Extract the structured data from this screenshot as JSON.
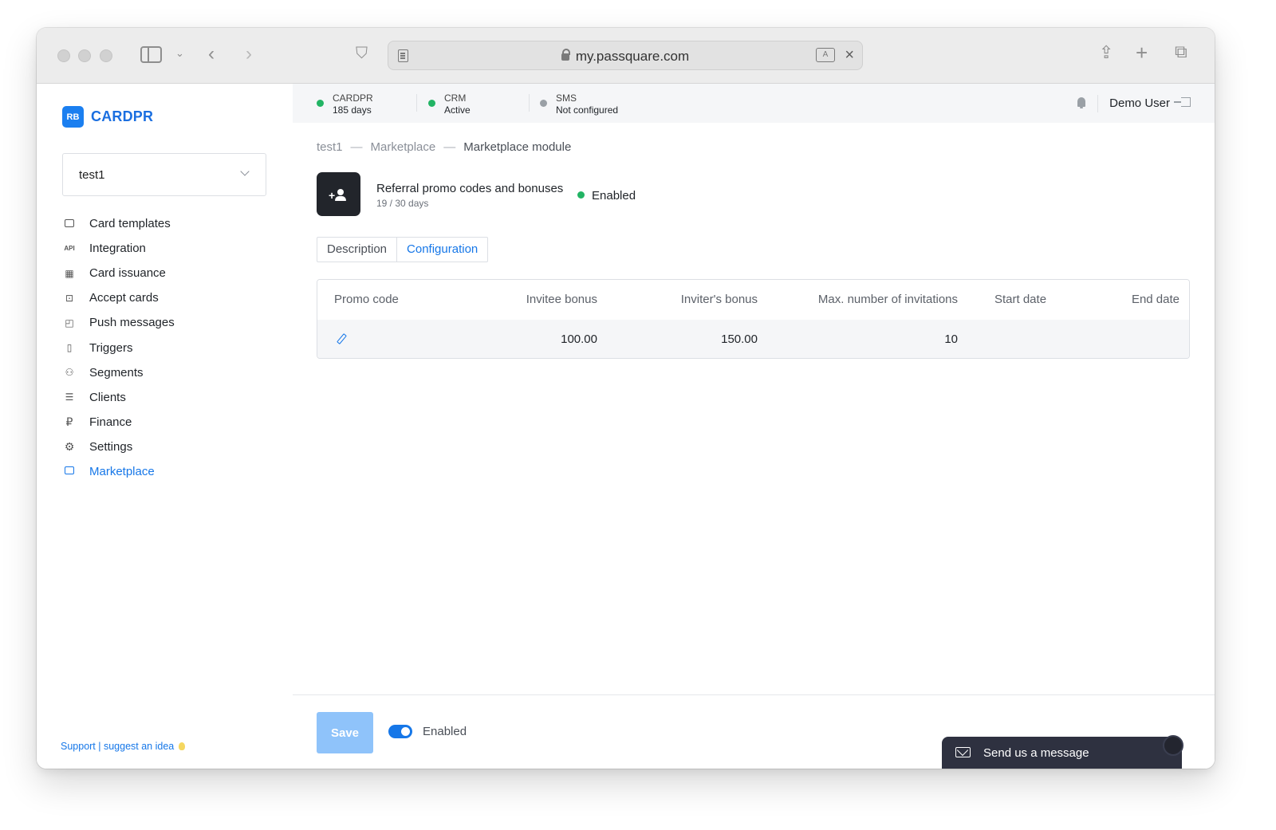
{
  "browser": {
    "url": "my.passquare.com",
    "translate_label": "A"
  },
  "sidebar": {
    "logo_mark": "RB",
    "logo_text": "CARDPR",
    "org_select": {
      "value": "test1"
    },
    "items": [
      {
        "label": "Card templates",
        "icon": "card-template-icon"
      },
      {
        "label": "Integration",
        "icon": "api-icon"
      },
      {
        "label": "Card issuance",
        "icon": "qr-code-icon"
      },
      {
        "label": "Accept cards",
        "icon": "scan-icon"
      },
      {
        "label": "Push messages",
        "icon": "push-message-icon"
      },
      {
        "label": "Triggers",
        "icon": "trigger-icon"
      },
      {
        "label": "Segments",
        "icon": "segments-icon"
      },
      {
        "label": "Clients",
        "icon": "clients-list-icon"
      },
      {
        "label": "Finance",
        "icon": "ruble-icon"
      },
      {
        "label": "Settings",
        "icon": "gear-icon"
      },
      {
        "label": "Marketplace",
        "icon": "store-icon",
        "active": true
      }
    ],
    "support": "Support | suggest an idea"
  },
  "statusbar": {
    "items": [
      {
        "name": "CARDPR",
        "value": "185 days",
        "color": "#22b464"
      },
      {
        "name": "CRM",
        "value": "Active",
        "color": "#22b464"
      },
      {
        "name": "SMS",
        "value": "Not configured",
        "color": "#9aa0a6"
      }
    ],
    "user": "Demo User"
  },
  "breadcrumb": [
    "test1",
    "Marketplace",
    "Marketplace module"
  ],
  "breadcrumb_separator": "—",
  "module": {
    "title": "Referral promo codes and bonuses",
    "subtitle": "19 / 30 days",
    "status": "Enabled",
    "status_color": "#22b464"
  },
  "tabs": [
    {
      "label": "Description",
      "active": false
    },
    {
      "label": "Configuration",
      "active": true
    }
  ],
  "table": {
    "headers": [
      "Promo code",
      "Invitee bonus",
      "Inviter's bonus",
      "Max. number of invitations",
      "Start date",
      "End date"
    ],
    "rows": [
      {
        "promo_code": "",
        "invitee_bonus": "100.00",
        "inviter_bonus": "150.00",
        "max_invitations": "10",
        "start_date": "",
        "end_date": ""
      }
    ]
  },
  "footer": {
    "save_label": "Save",
    "toggle_label": "Enabled",
    "toggle_on": true
  },
  "chat": {
    "label": "Send us a message"
  },
  "colors": {
    "accent": "#1677e8",
    "brand": "#1b7ff0",
    "save_disabled": "#8fc3fa",
    "chat_bg": "#2e3140"
  }
}
